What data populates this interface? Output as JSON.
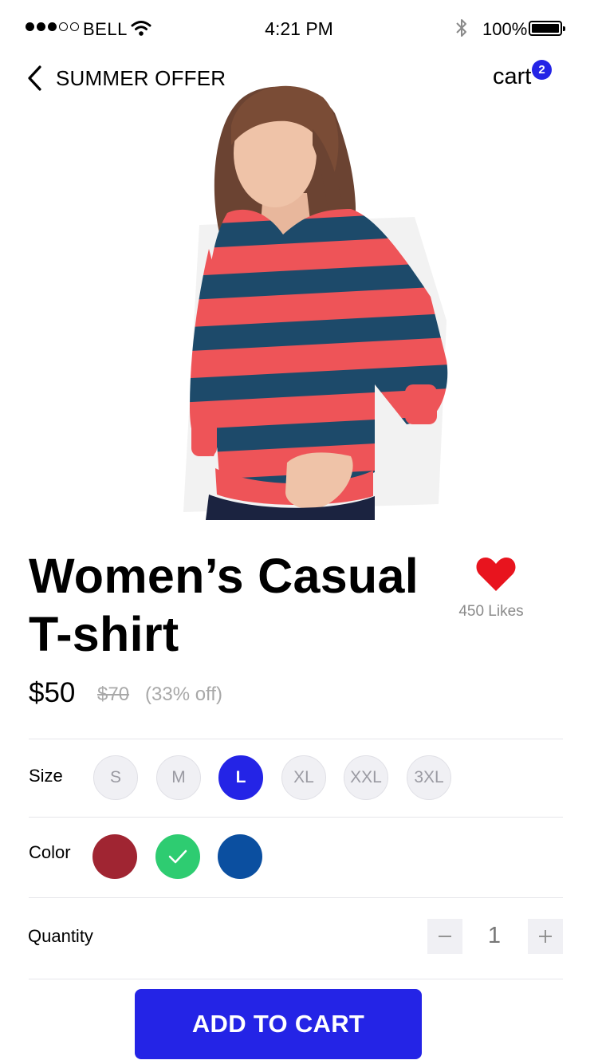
{
  "status_bar": {
    "carrier": "BELL",
    "time": "4:21 PM",
    "battery": "100%",
    "signal_full_dots": 3,
    "signal_total_dots": 5
  },
  "header": {
    "title": "SUMMER OFFER",
    "cart_label": "cart",
    "cart_count": "2",
    "back_icon": "chevron-left-icon"
  },
  "product": {
    "title": "Women’s Casual T-shirt",
    "likes": "450 Likes",
    "like_icon": "heart-icon",
    "price": "$50",
    "old_price": "$70",
    "discount": "(33% off)"
  },
  "size": {
    "label": "Size",
    "options": [
      "S",
      "M",
      "L",
      "XL",
      "XXL",
      "3XL"
    ],
    "selected": "L"
  },
  "color": {
    "label": "Color",
    "options": [
      "#a02532",
      "#2ecc71",
      "#0b4fa0"
    ],
    "selected_index": 1
  },
  "quantity": {
    "label": "Quantity",
    "value": "1",
    "decrement": "−",
    "increment": "+"
  },
  "cta": {
    "label": "ADD TO CART"
  },
  "colors": {
    "accent": "#2424e6",
    "heart": "#e8141e",
    "shirt_coral": "#ee5458",
    "shirt_navy": "#1d4a6a"
  }
}
